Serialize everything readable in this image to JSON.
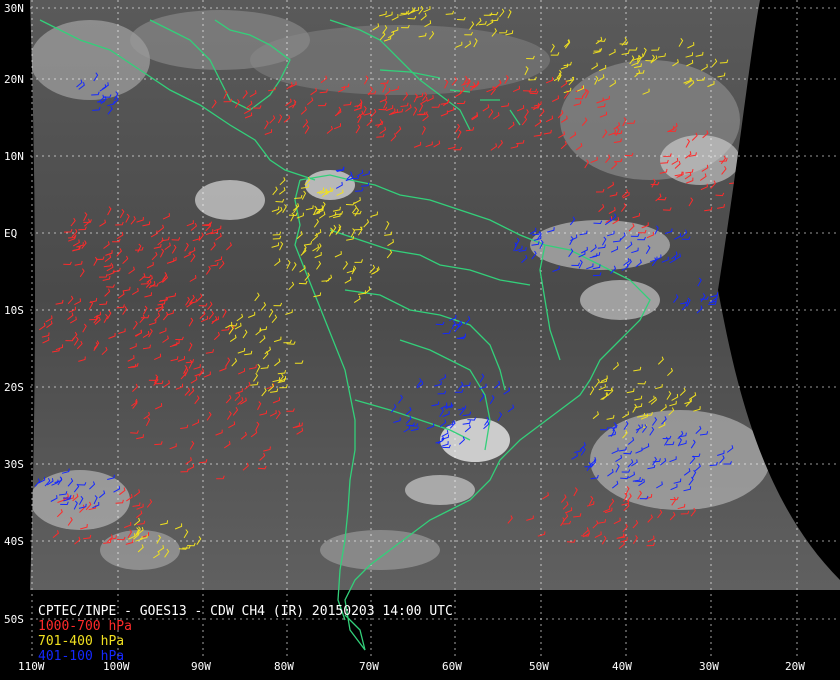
{
  "map": {
    "latitude_labels": [
      "30N",
      "20N",
      "10N",
      "EQ",
      "10S",
      "20S",
      "30S",
      "40S",
      "50S"
    ],
    "longitude_labels": [
      "110W",
      "100W",
      "90W",
      "80W",
      "70W",
      "60W",
      "50W",
      "40W",
      "30W",
      "20W"
    ]
  },
  "caption": {
    "title": "CPTEC/INPE - GOES13 - CDW CH4 (IR) 20150203 14:00 UTC",
    "legend": [
      {
        "label": "1000-700 hPa",
        "color": "#ff2a2a"
      },
      {
        "label": "701-400 hPa",
        "color": "#f0e020"
      },
      {
        "label": "401-100 hPa",
        "color": "#1428ff"
      }
    ]
  },
  "colors": {
    "background": "#000000",
    "coastline": "#33d07a",
    "grid": "#ffffff"
  }
}
